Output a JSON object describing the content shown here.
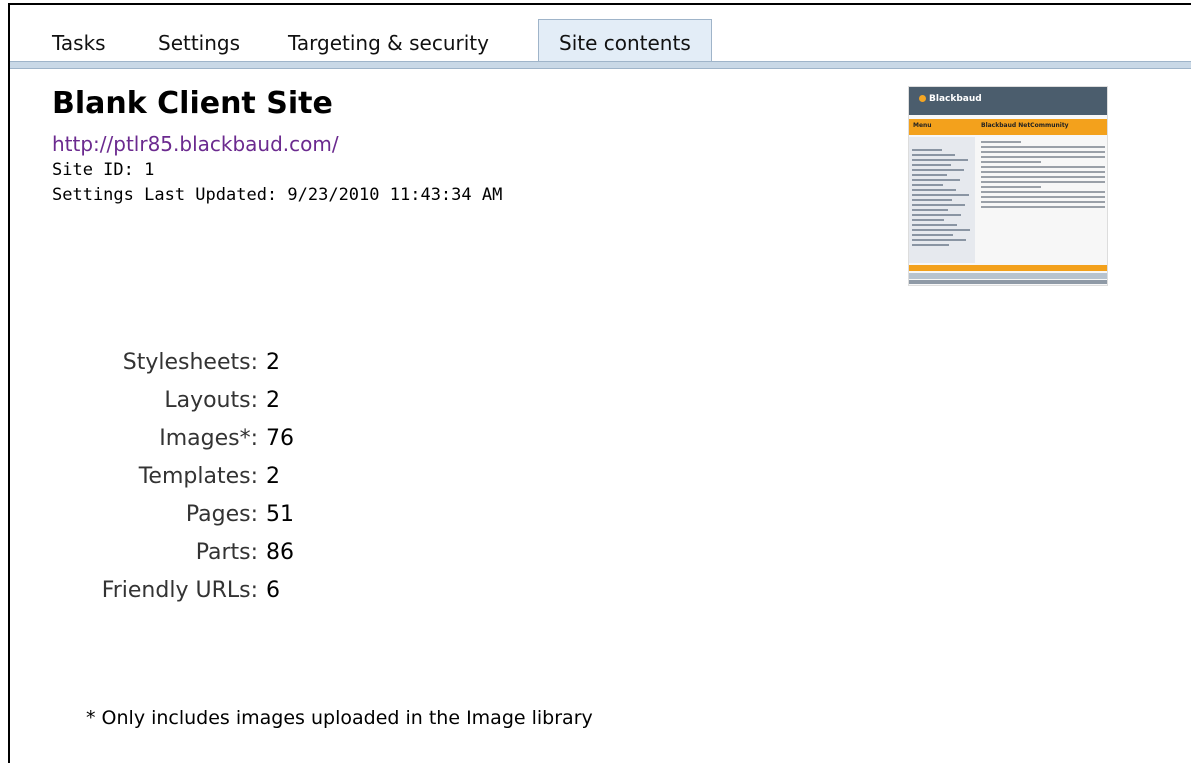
{
  "tabs": [
    {
      "label": "Tasks",
      "active": false
    },
    {
      "label": "Settings",
      "active": false
    },
    {
      "label": "Targeting & security",
      "active": false
    },
    {
      "label": "Site contents",
      "active": true
    }
  ],
  "site": {
    "title": "Blank Client Site",
    "url": "http://ptlr85.blackbaud.com/",
    "site_id_line": "Site ID: 1",
    "updated_line": "Settings Last Updated: 9/23/2010 11:43:34 AM"
  },
  "thumbnail": {
    "logo": "Blackbaud",
    "menu_label": "Menu",
    "content_label": "Blackbaud NetCommunity"
  },
  "stats": [
    {
      "label": "Stylesheets:",
      "value": "2"
    },
    {
      "label": "Layouts:",
      "value": "2"
    },
    {
      "label": "Images*:",
      "value": "76"
    },
    {
      "label": "Templates:",
      "value": "2"
    },
    {
      "label": "Pages:",
      "value": "51"
    },
    {
      "label": "Parts:",
      "value": "86"
    },
    {
      "label": "Friendly URLs:",
      "value": "6"
    }
  ],
  "footnote": "* Only includes images uploaded in the Image library",
  "colors": {
    "tab_active_bg": "#e3edf7",
    "tab_border": "#9fb4c9",
    "link": "#6b2a8f"
  }
}
